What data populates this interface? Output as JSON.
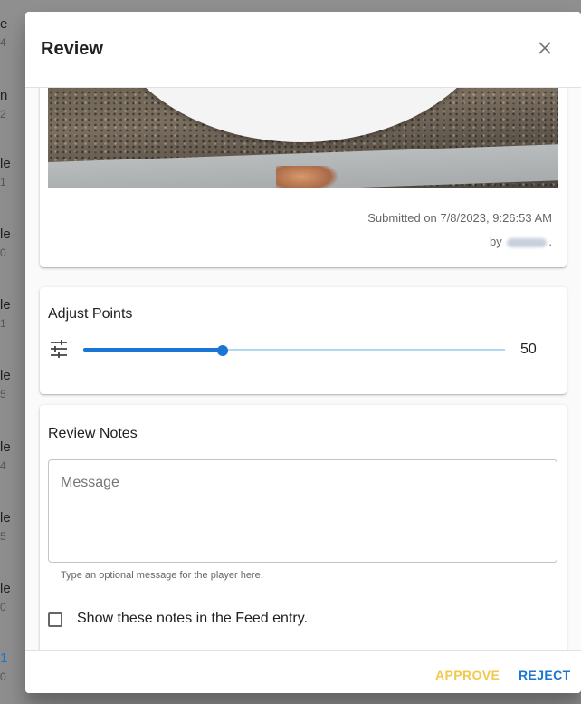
{
  "background_list": [
    {
      "title": "e",
      "sub": "4"
    },
    {
      "title": "n",
      "sub": "2"
    },
    {
      "title": "le",
      "sub": "1"
    },
    {
      "title": "le",
      "sub": "0"
    },
    {
      "title": "le",
      "sub": "1"
    },
    {
      "title": "le",
      "sub": "5"
    },
    {
      "title": "le",
      "sub": "4"
    },
    {
      "title": "le",
      "sub": "5"
    },
    {
      "title": "le",
      "sub": "0"
    },
    {
      "title": "1",
      "sub": "0"
    }
  ],
  "dialog": {
    "title": "Review",
    "close_icon": "close-icon"
  },
  "submission": {
    "submitted_text": "Submitted on 7/8/2023, 9:26:53 AM",
    "by_prefix": "by",
    "by_suffix": "."
  },
  "points": {
    "title": "Adjust Points",
    "icon": "tune-icon",
    "value": "50",
    "slider_fraction": 0.33
  },
  "notes": {
    "title": "Review Notes",
    "placeholder": "Message",
    "helper": "Type an optional message for the player here.",
    "checkbox_label": "Show these notes in the Feed entry.",
    "checkbox_checked": false
  },
  "actions": {
    "approve": "APPROVE",
    "reject": "REJECT"
  },
  "colors": {
    "primary": "#1976d2",
    "approve": "#f2c94c"
  }
}
